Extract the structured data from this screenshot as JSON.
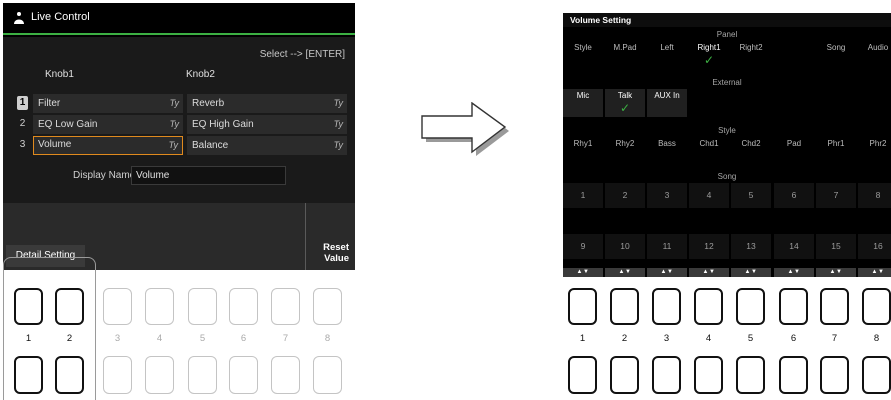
{
  "left_screen": {
    "title": "Live Control",
    "select_hint": "Select --> [ENTER]",
    "knob1_header": "Knob1",
    "knob2_header": "Knob2",
    "rows": [
      {
        "num": "1",
        "knob1": "Filter",
        "knob1_tag": "Ty",
        "knob2": "Reverb",
        "knob2_tag": "Ty"
      },
      {
        "num": "2",
        "knob1": "EQ Low Gain",
        "knob1_tag": "Ty",
        "knob2": "EQ High Gain",
        "knob2_tag": "Ty"
      },
      {
        "num": "3",
        "knob1": "Volume",
        "knob1_tag": "Ty",
        "knob2": "Balance",
        "knob2_tag": "Ty"
      }
    ],
    "display_name_label": "Display Name",
    "display_name_value": "Volume",
    "detail_setting": "Detail Setting",
    "reset_value_line1": "Reset",
    "reset_value_line2": "Value",
    "buttons": [
      "1",
      "2",
      "3",
      "4",
      "5",
      "6",
      "7",
      "8"
    ]
  },
  "right_screen": {
    "title": "Volume Setting",
    "panel_header": "Panel",
    "panel_cells": [
      "Style",
      "M.Pad",
      "Left",
      "Right1",
      "Right2",
      "",
      "Song",
      "Audio"
    ],
    "external_header": "External",
    "external_cells": [
      "Mic",
      "Talk",
      "AUX In"
    ],
    "style_header": "Style",
    "style_cells": [
      "Rhy1",
      "Rhy2",
      "Bass",
      "Chd1",
      "Chd2",
      "Pad",
      "Phr1",
      "Phr2"
    ],
    "song_header": "Song",
    "song_row1": [
      "1",
      "2",
      "3",
      "4",
      "5",
      "6",
      "7",
      "8"
    ],
    "song_row2": [
      "9",
      "10",
      "11",
      "12",
      "13",
      "14",
      "15",
      "16"
    ],
    "arrow_label": "▲▼",
    "check_mark": "✓",
    "buttons": [
      "1",
      "2",
      "3",
      "4",
      "5",
      "6",
      "7",
      "8"
    ]
  },
  "colors": {
    "accent_green": "#3cb043",
    "selection_orange": "#e08a1e"
  }
}
